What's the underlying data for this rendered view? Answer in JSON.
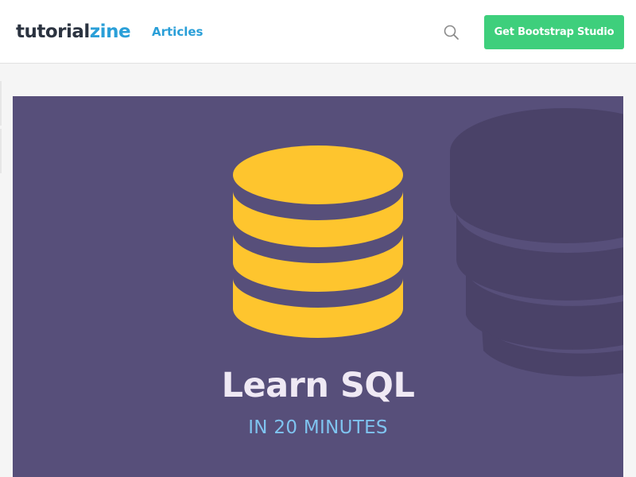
{
  "header": {
    "logo": {
      "part1": "tutorial",
      "part2": "zine"
    },
    "nav": {
      "articles_label": "Articles"
    },
    "search_icon": "search-icon",
    "cta_label": "Get Bootstrap Studio"
  },
  "hero": {
    "icon": "database-icon",
    "title": "Learn SQL",
    "subtitle": "IN 20 MINUTES"
  },
  "colors": {
    "brand_dark": "#2b3340",
    "brand_blue": "#2a9fd8",
    "cta_green": "#3ecf7c",
    "hero_bg": "#574f7a",
    "db_yellow": "#fec52e",
    "title_text": "#efe9f4",
    "subtitle_text": "#7fc4f0"
  }
}
